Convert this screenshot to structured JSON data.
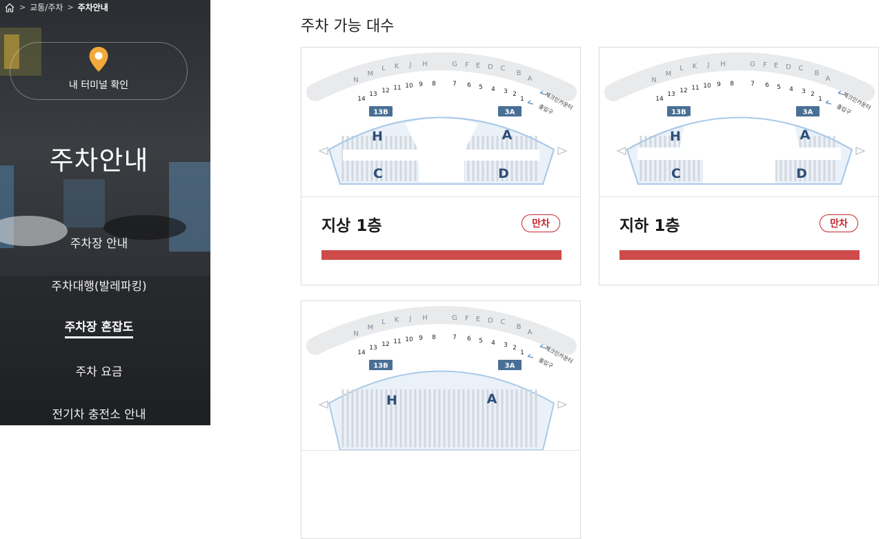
{
  "breadcrumb": {
    "items": [
      "교통/주차",
      "주차안내"
    ],
    "sep": ">"
  },
  "sidebar": {
    "terminal_label": "내 터미널 확인",
    "title": "주차안내",
    "nav": [
      {
        "label": "주차장 안내",
        "active": false
      },
      {
        "label": "주차대행(발레파킹)",
        "active": false
      },
      {
        "label": "주차장 혼잡도",
        "active": true
      },
      {
        "label": "주차 요금",
        "active": false
      },
      {
        "label": "전기차 충전소 안내",
        "active": false
      }
    ]
  },
  "main": {
    "title": "주차 가능 대수"
  },
  "map": {
    "counter_letters": [
      "N",
      "M",
      "L",
      "K",
      "J",
      "H",
      "G",
      "F",
      "E",
      "D",
      "C",
      "B",
      "A"
    ],
    "gate_numbers": [
      "14",
      "13",
      "12",
      "11",
      "10",
      "9",
      "8",
      "7",
      "6",
      "5",
      "4",
      "3",
      "2",
      "1"
    ],
    "gate_tags": [
      "13B",
      "3A"
    ],
    "checkin_label": "체크인카운터",
    "entrance_label": "출입구",
    "zone_labels": [
      "H",
      "A",
      "C",
      "D"
    ]
  },
  "floors": [
    {
      "name": "지상 1층",
      "status": "만차",
      "occupancy_percent": 100
    },
    {
      "name": "지하 1층",
      "status": "만차",
      "occupancy_percent": 100
    },
    {
      "name": "",
      "status": "",
      "occupancy_percent": 0
    }
  ],
  "colors": {
    "full": "#cd4b4b",
    "badge": "#c0272d",
    "gate_tag": "#4a6f95",
    "zone_text": "#2d4e78",
    "zone_stroke": "#a9c9e8"
  }
}
